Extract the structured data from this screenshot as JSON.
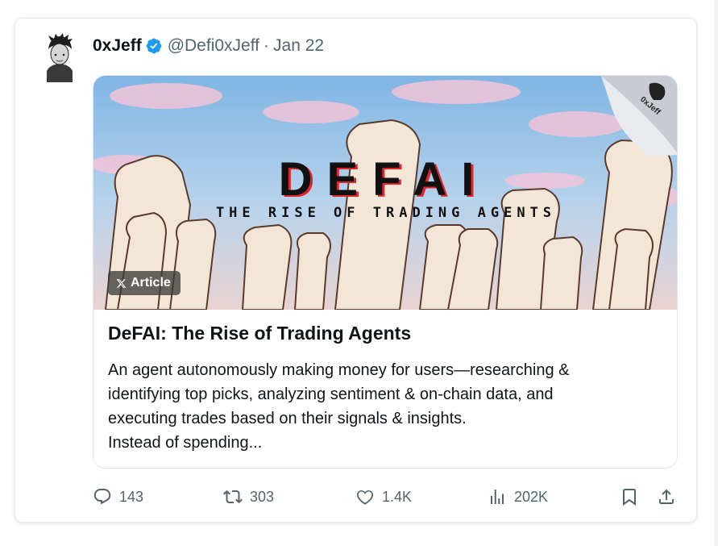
{
  "tweet": {
    "author_name": "0xJeff",
    "handle": "@Defi0xJeff",
    "separator": "·",
    "date": "Jan 22"
  },
  "article": {
    "badge": "Article",
    "image_title": "DEFAI",
    "image_subtitle": "THE RISE OF TRADING AGENTS",
    "image_watermark": "0xJeff",
    "title": "DeFAI: The Rise of Trading Agents",
    "excerpt": "An agent autonomously making money for users—researching &\nidentifying top picks, analyzing sentiment & on-chain data, and\nexecuting trades based on their signals & insights.\nInstead of spending..."
  },
  "actions": {
    "replies": "143",
    "reposts": "303",
    "likes": "1.4K",
    "views": "202K"
  },
  "colors": {
    "verified_blue": "#1d9bf0",
    "text_primary": "#0f1419",
    "text_secondary": "#536471"
  }
}
